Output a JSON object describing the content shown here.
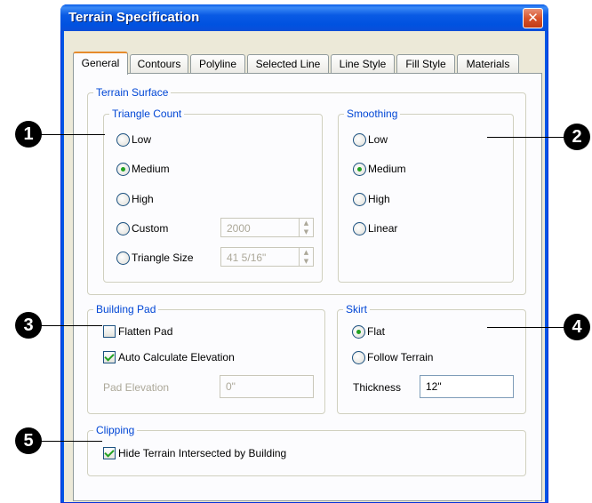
{
  "dialog": {
    "title": "Terrain Specification",
    "close_symbol": "✕"
  },
  "tabs": [
    {
      "label": "General",
      "active": true
    },
    {
      "label": "Contours"
    },
    {
      "label": "Polyline"
    },
    {
      "label": "Selected Line"
    },
    {
      "label": "Line Style"
    },
    {
      "label": "Fill Style"
    },
    {
      "label": "Materials"
    }
  ],
  "terrain_surface": {
    "label": "Terrain Surface",
    "triangle_count": {
      "label": "Triangle Count",
      "options": [
        "Low",
        "Medium",
        "High",
        "Custom",
        "Triangle Size"
      ],
      "selected": "Medium",
      "custom_value": "2000",
      "triangle_size_value": "41 5/16\""
    },
    "smoothing": {
      "label": "Smoothing",
      "options": [
        "Low",
        "Medium",
        "High",
        "Linear"
      ],
      "selected": "Medium"
    }
  },
  "building_pad": {
    "label": "Building Pad",
    "flatten_pad": {
      "label": "Flatten Pad",
      "checked": false
    },
    "auto_calc": {
      "label": "Auto Calculate Elevation",
      "checked": true
    },
    "pad_elevation": {
      "label": "Pad Elevation",
      "value": "0\""
    }
  },
  "skirt": {
    "label": "Skirt",
    "options": [
      "Flat",
      "Follow Terrain"
    ],
    "selected": "Flat",
    "thickness": {
      "label": "Thickness",
      "value": "12\""
    }
  },
  "clipping": {
    "label": "Clipping",
    "hide_terrain": {
      "label": "Hide Terrain Intersected by Building",
      "checked": true
    }
  },
  "callouts": [
    "1",
    "2",
    "3",
    "4",
    "5"
  ],
  "colors": {
    "title_bar": "#0a5ae4",
    "group_label": "#0046d5",
    "check_mark": "#21a121"
  }
}
